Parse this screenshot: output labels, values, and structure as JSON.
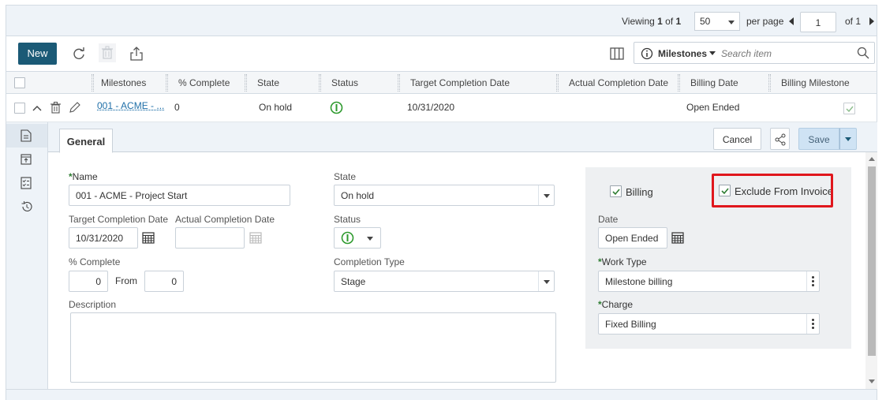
{
  "pager": {
    "viewing_prefix": "Viewing ",
    "viewing_current": "1",
    "viewing_of": " of ",
    "viewing_total": "1",
    "page_size": "50",
    "per_page_label": "per page",
    "page_number": "1",
    "of_pages": "of 1"
  },
  "toolbar": {
    "new_label": "New",
    "search_scope": "Milestones",
    "search_placeholder": "Search item"
  },
  "grid": {
    "columns": [
      "Milestones",
      "% Complete",
      "State",
      "Status",
      "Target Completion Date",
      "Actual Completion Date",
      "Billing Date",
      "Billing Milestone"
    ],
    "row": {
      "milestone": "001 - ACME - ...",
      "percent_complete": "0",
      "state": "On hold",
      "target_date": "10/31/2020",
      "billing_date": "Open Ended"
    }
  },
  "detail": {
    "tab_general": "General",
    "cancel_label": "Cancel",
    "save_label": "Save",
    "name_label": "Name",
    "name_value": "001 - ACME - Project Start",
    "target_date_label": "Target Completion Date",
    "target_date_value": "10/31/2020",
    "actual_date_label": "Actual Completion Date",
    "actual_date_value": "",
    "percent_label": "% Complete",
    "percent_value": "0",
    "from_label": "From",
    "from_value": "0",
    "description_label": "Description",
    "description_value": "",
    "state_label": "State",
    "state_value": "On hold",
    "status_label": "Status",
    "completion_type_label": "Completion Type",
    "completion_type_value": "Stage",
    "billing_label": "Billing",
    "exclude_label": "Exclude From Invoice",
    "date_label": "Date",
    "date_value": "Open Ended",
    "work_type_label": "Work Type",
    "work_type_value": "Milestone billing",
    "charge_label": "Charge",
    "charge_value": "Fixed Billing",
    "required_marker": "*"
  },
  "colors": {
    "primary": "#1b5a76",
    "status_green": "#2e9a2e",
    "highlight_red": "#e0171d",
    "check_green": "#2e7d32"
  }
}
